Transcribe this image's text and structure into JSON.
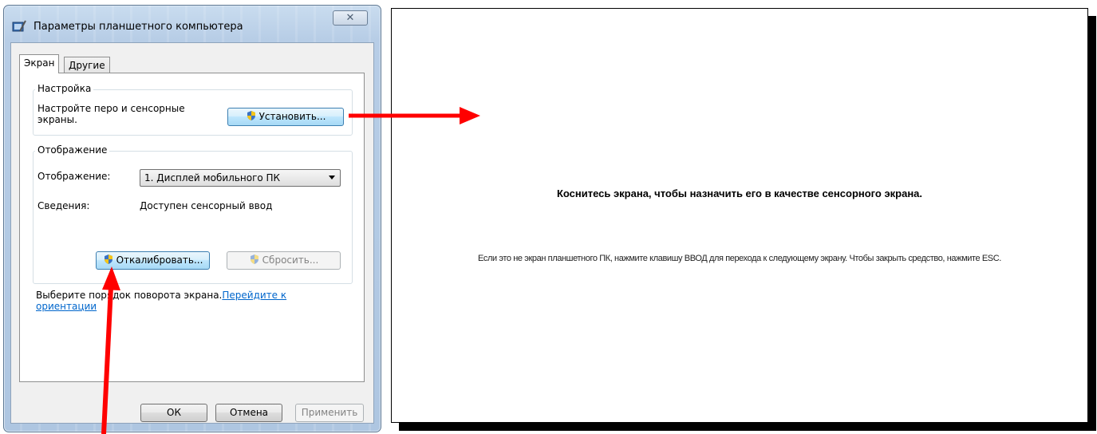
{
  "dialog": {
    "title": "Параметры планшетного компьютера",
    "close_glyph": "✕",
    "tabs": [
      {
        "label": "Экран",
        "active": true
      },
      {
        "label": "Другие",
        "active": false
      }
    ],
    "setup_group": {
      "label": "Настройка",
      "description_line1": "Настройте перо и сенсорные",
      "description_line2": "экраны.",
      "setup_button": "Установить..."
    },
    "display_group": {
      "label": "Отображение",
      "display_label": "Отображение:",
      "display_selected": "1. Дисплей мобильного ПК",
      "details_label": "Сведения:",
      "details_value": "Доступен сенсорный ввод",
      "calibrate_button": "Откалибровать...",
      "reset_button": "Сбросить..."
    },
    "orientation": {
      "text": "Выберите порядок поворота экрана.",
      "link_part1": "Перейдите к",
      "link_part2": "ориентации"
    },
    "footer": {
      "ok": "ОК",
      "cancel": "Отмена",
      "apply": "Применить"
    }
  },
  "calibration_screen": {
    "main_text": "Коснитесь экрана, чтобы назначить его в качестве сенсорного экрана.",
    "sub_text": "Если это не экран планшетного ПК, нажмите клавишу ВВОД для перехода к следующему экрану. Чтобы закрыть средство, нажмите ESC."
  },
  "colors": {
    "arrow": "#ff0000",
    "link": "#0066cc",
    "window_frame": "#aec6e1"
  }
}
